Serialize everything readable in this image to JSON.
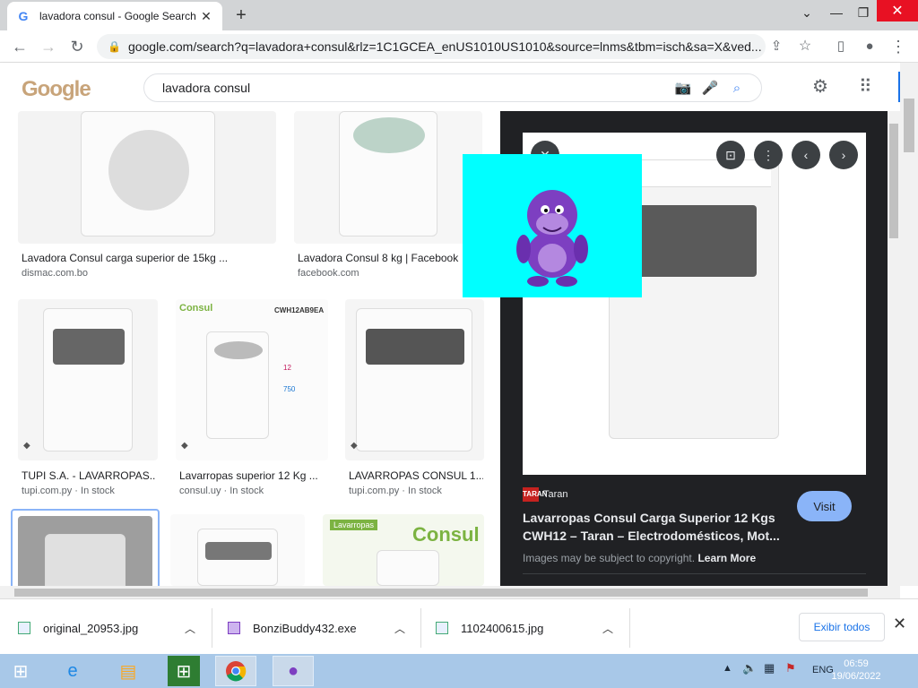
{
  "browser": {
    "tab_title": "lavadora consul - Google Search",
    "tab_close": "✕",
    "new_tab": "+",
    "url": "google.com/search?q=lavadora+consul&rlz=1C1GCEA_enUS1010US1010&source=lnms&tbm=isch&sa=X&ved..."
  },
  "google": {
    "logo_text": "Google",
    "query": "lavadora consul"
  },
  "results": [
    {
      "title": "Lavadora Consul carga superior de 15kg ...",
      "source": "dismac.com.bo"
    },
    {
      "title": "Lavadora Consul 8 kg | Facebook",
      "source": "facebook.com"
    },
    {
      "title": "TUPI S.A. - LAVARROPAS...",
      "source": "tupi.com.py · In stock"
    },
    {
      "title": "Lavarropas superior 12 Kg ...",
      "source": "consul.uy · In stock"
    },
    {
      "title": "LAVARROPAS CONSUL 1...",
      "source": "tupi.com.py · In stock"
    }
  ],
  "thumb_labels": {
    "consul_brand": "Consul",
    "model": "CWH12AB9EA",
    "kg": "12",
    "rpm": "750",
    "lavarropas": "Lavarropas",
    "consul_big": "Consul"
  },
  "preview": {
    "source_name": "Taran",
    "source_logo": "TARAN",
    "title": "Lavarropas Consul Carga Superior 12 Kgs CWH12 – Taran – Electrodomésticos, Mot...",
    "visit_label": "Visit",
    "copyright_text": "Images may be subject to copyright.",
    "learn_more": "Learn More"
  },
  "downloads": {
    "items": [
      {
        "name": "original_20953.jpg"
      },
      {
        "name": "BonziBuddy432.exe"
      },
      {
        "name": "1102400615.jpg"
      }
    ],
    "show_all": "Exibir todos"
  },
  "taskbar": {
    "lang": "ENG",
    "time": "06:59",
    "date": "19/06/2022"
  }
}
